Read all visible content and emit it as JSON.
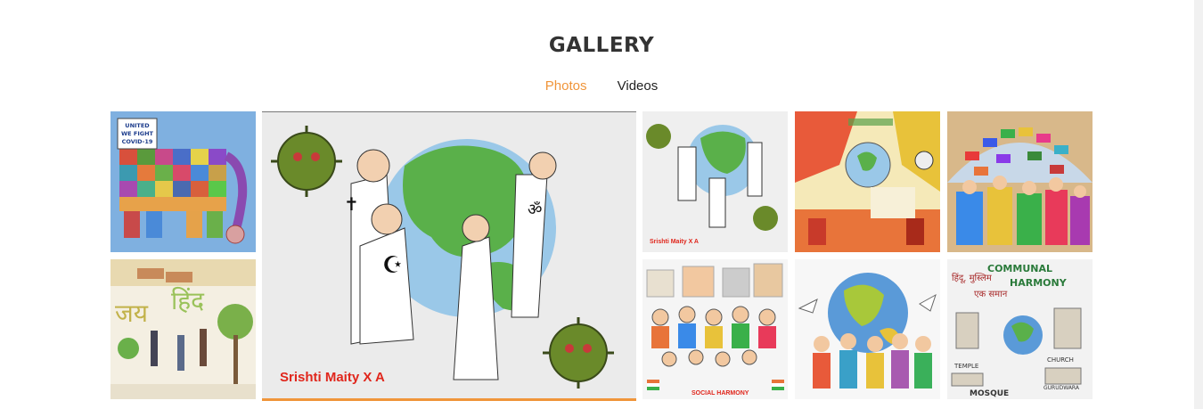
{
  "gallery": {
    "title": "GALLERY",
    "tabs": [
      {
        "label": "Photos",
        "active": true
      },
      {
        "label": "Videos",
        "active": false
      }
    ],
    "accent_color": "#f0953a",
    "featured_caption": "Srishti Maity X A",
    "tile3_caption": "Srishti Maity X A",
    "tile1_badge": [
      "UNITED",
      "WE FIGHT",
      "COVID-19"
    ],
    "tile10_words": [
      "COMMUNAL",
      "HARMONY",
      "CHURCH",
      "TEMPLE",
      "MOSQUE",
      "GURUDWARA"
    ],
    "tile7_caption": "SOCIAL HARMONY"
  }
}
